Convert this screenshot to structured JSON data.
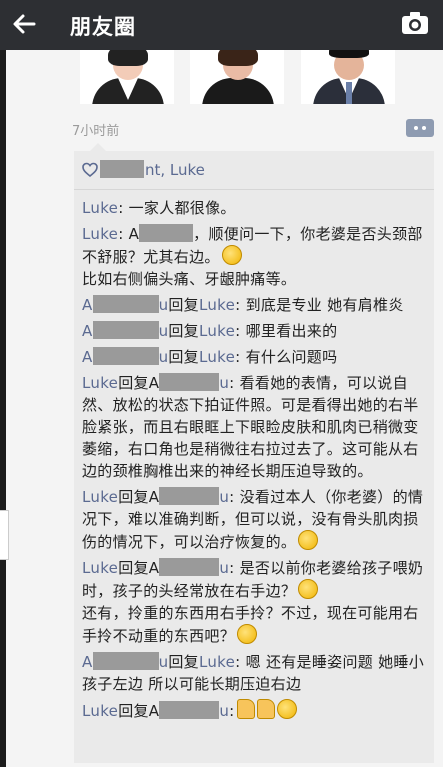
{
  "header": {
    "title": "朋友圈"
  },
  "post": {
    "time": "7小时前"
  },
  "likes": {
    "names": "nt, Luke"
  },
  "comments": [
    {
      "name": "Luke",
      "sep": ": ",
      "text": "一家人都很像。"
    },
    {
      "name": "Luke",
      "sep": ": A",
      "text_after_redact": "，顺便问一下，你老婆是否头颈部不舒服？尤其右边。",
      "line3": "比如右侧偏头痛、牙龈肿痛等。"
    },
    {
      "name_redacted_suffix": "u",
      "reply": "回复",
      "target": "Luke",
      "text": ": 到底是专业 她有肩椎炎"
    },
    {
      "name_redacted_suffix": "u",
      "reply": "回复",
      "target": "Luke",
      "text": ": 哪里看出来的"
    },
    {
      "name_redacted_suffix": "u",
      "reply": "回复",
      "target": "Luke",
      "text": ": 有什么问题吗"
    },
    {
      "name": "Luke",
      "reply": "回复A",
      "target_suffix": "u",
      "text": ": 看看她的表情，可以说自然、放松的状态下拍证件照。可是看得出她的右半脸紧张，而且右眼眶上下眼睑皮肤和肌肉已稍微变萎缩，右口角也是稍微往右拉过去了。这可能从右边的颈椎胸椎出来的神经长期压迫导致的。"
    },
    {
      "name": "Luke",
      "reply": "回复A",
      "target_suffix": "u",
      "text": ": 没看过本人（你老婆）的情况下，难以准确判断，但可以说，没有骨头肌肉损伤的情况下，可以治疗恢复的。"
    },
    {
      "name": "Luke",
      "reply": "回复A",
      "target_suffix": "u",
      "text": ": 是否以前你老婆给孩子喂奶时，孩子的头经常放在右手边？",
      "line2": "还有，拎重的东西用右手拎？不过，现在可能用右手拎不动重的东西吧？"
    },
    {
      "name_redacted_suffix": "u",
      "reply": "回复",
      "target": "Luke",
      "text": ": 嗯 还有是睡姿问题 她睡小孩子左边 所以可能长期压迫右边"
    },
    {
      "name": "Luke",
      "reply": "回复A",
      "target_suffix": "u",
      "text": ":"
    }
  ],
  "icons": {
    "back": "back-arrow-icon",
    "camera": "camera-icon",
    "heart": "heart-icon",
    "comment": "comment-icon"
  },
  "colors": {
    "topbar": "#2d2f33",
    "name": "#5b6a91",
    "panel": "#eaeaea"
  }
}
